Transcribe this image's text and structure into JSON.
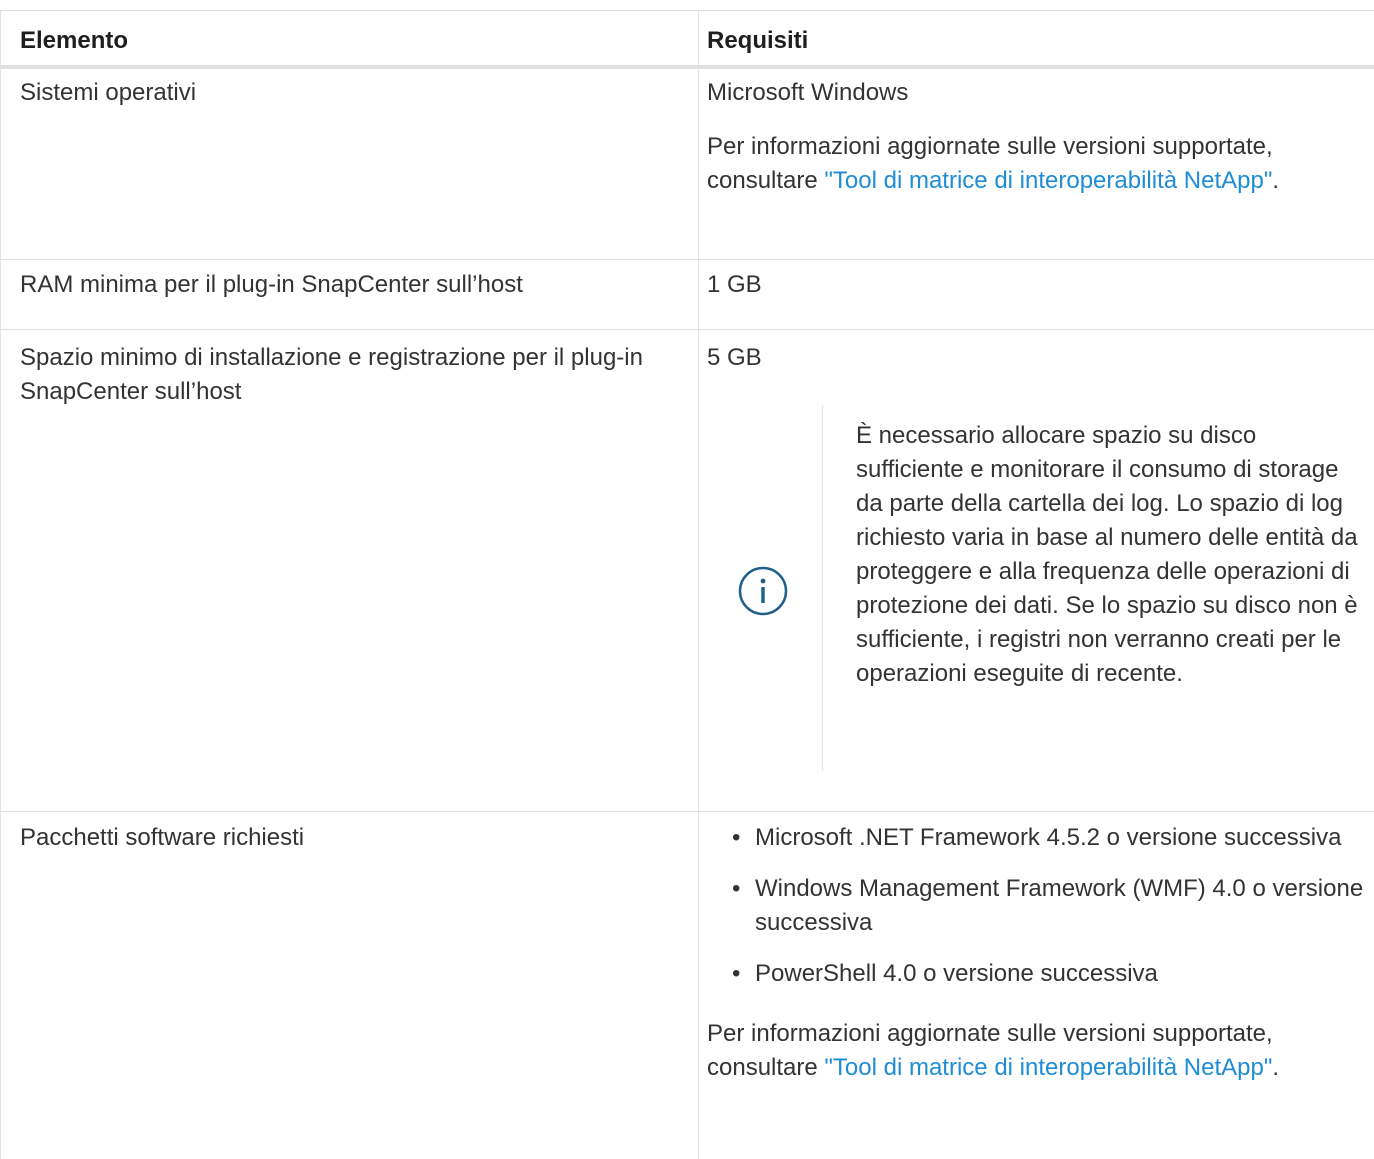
{
  "table": {
    "headers": {
      "element": "Elemento",
      "requirements": "Requisiti"
    },
    "rows": [
      {
        "element": "Sistemi operativi",
        "requirement_main": "Microsoft Windows",
        "info_prefix": "Per informazioni aggiornate sulle versioni supportate, consultare ",
        "link_text": "\"Tool di matrice di interoperabilità NetApp\"",
        "info_suffix": "."
      },
      {
        "element": "RAM minima per il plug-in SnapCenter sull’host",
        "requirement_main": "1 GB"
      },
      {
        "element": "Spazio minimo di installazione e registrazione per il plug-in SnapCenter sull’host",
        "requirement_main": "5 GB",
        "note_icon": "info-icon",
        "note_text": "È necessario allocare spazio su disco sufficiente e monitorare il consumo di storage da parte della cartella dei log. Lo spazio di log richiesto varia in base al numero delle entità da proteggere e alla frequenza delle operazioni di protezione dei dati. Se lo spazio su disco non è sufficiente, i registri non verranno creati per le operazioni eseguite di recente."
      },
      {
        "element": "Pacchetti software richiesti",
        "items": [
          "Microsoft .NET Framework 4.5.2 o versione successiva",
          "Windows Management Framework (WMF) 4.0 o versione successiva",
          "PowerShell 4.0 o versione successiva"
        ],
        "info_prefix": "Per informazioni aggiornate sulle versioni supportate, consultare ",
        "link_text": "\"Tool di matrice di interoperabilità NetApp\"",
        "info_suffix": "."
      }
    ]
  },
  "colors": {
    "text": "#333333",
    "link": "#1f8dd6",
    "border": "#dedede",
    "icon": "#1f5f8b"
  }
}
